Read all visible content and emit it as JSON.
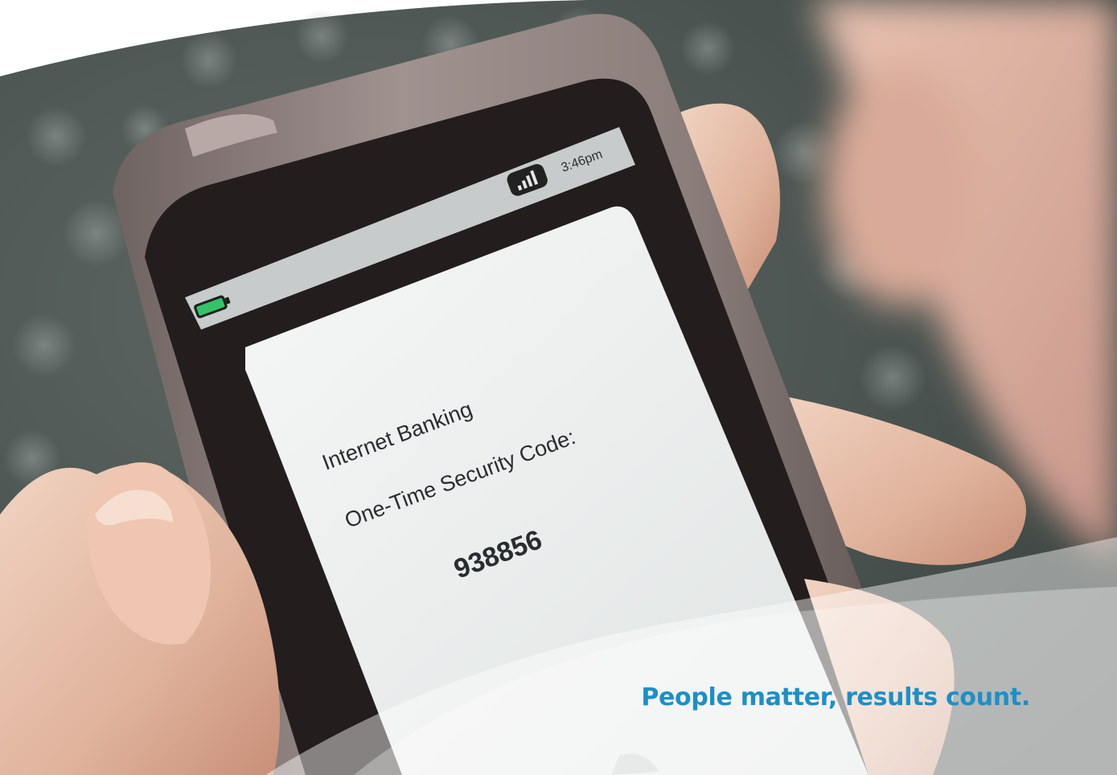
{
  "phone": {
    "status_time": "3:46pm",
    "battery_icon": "battery-icon",
    "signal_icon": "signal-bars-icon",
    "message": {
      "title": "Internet Banking",
      "label": "One-Time Security Code:",
      "code": "938856"
    }
  },
  "tagline": {
    "text": "People matter, results count."
  },
  "colors": {
    "tagline": "#1d8fc7",
    "battery": "#33c46a",
    "phone_body": "#8a7d7c",
    "screen_card": "#e8ebea"
  }
}
